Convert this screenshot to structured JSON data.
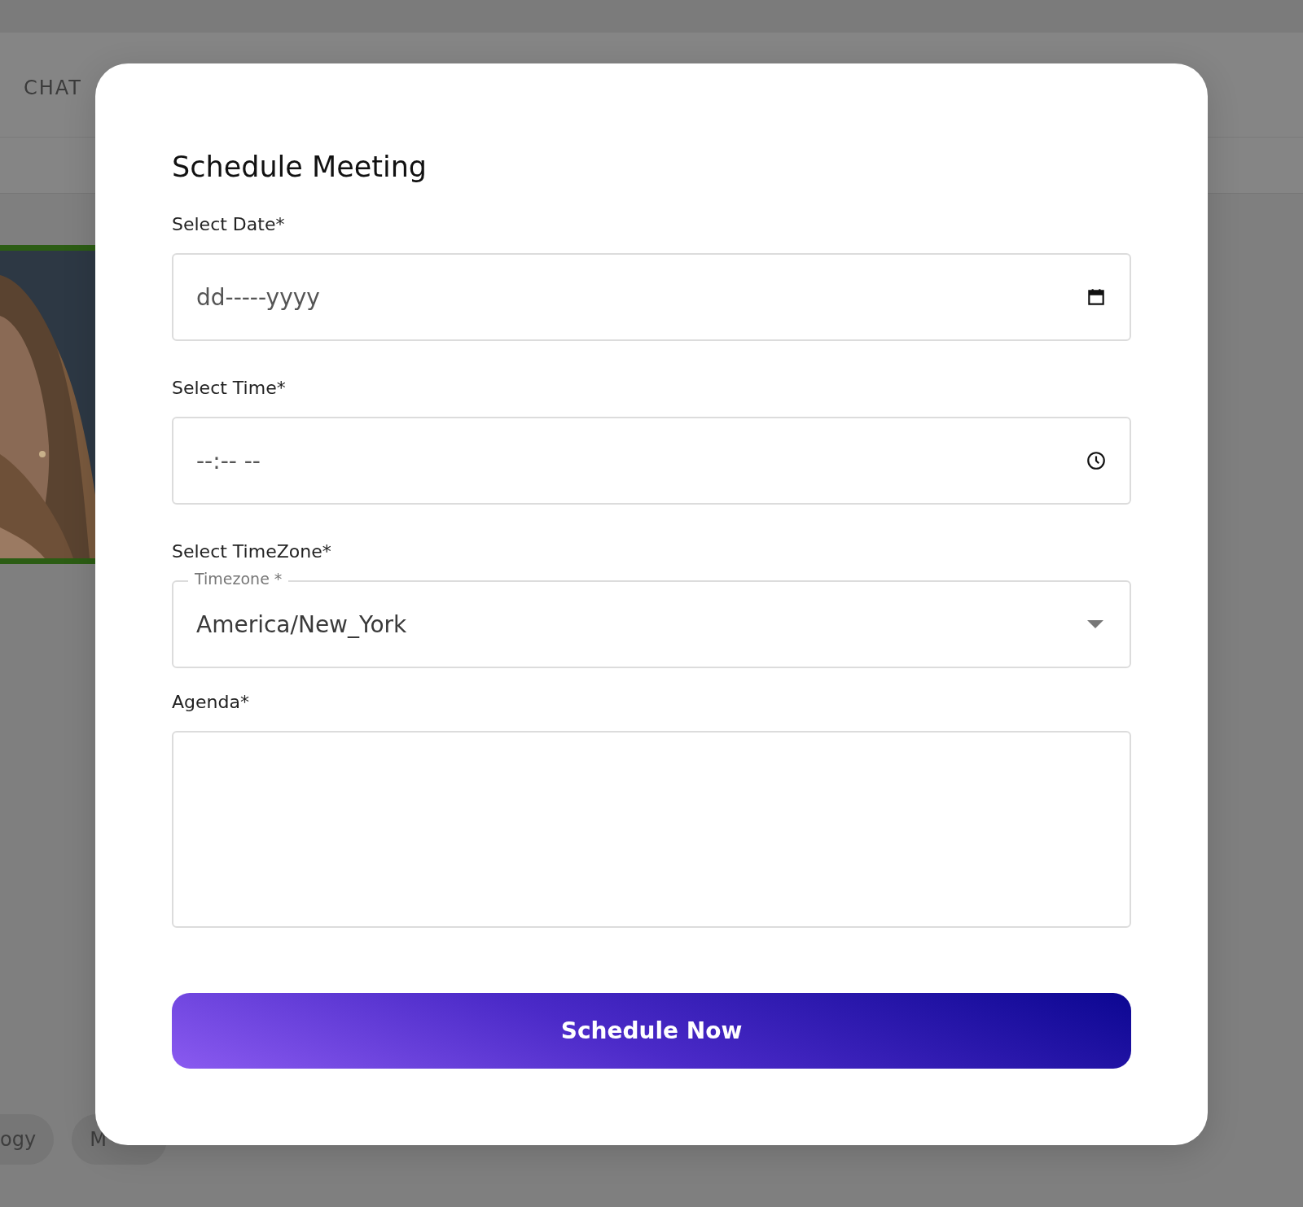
{
  "background": {
    "nav": [
      {
        "label": "CHAT"
      }
    ],
    "tags": [
      {
        "label": "ogy"
      },
      {
        "label": "M"
      }
    ]
  },
  "dialog": {
    "title": "Schedule Meeting",
    "fields": [
      {
        "kind": "date",
        "label": "Select Date*",
        "placeholder": "dd-----yyyy"
      },
      {
        "kind": "time",
        "label": "Select Time*",
        "placeholder": "--:-- --"
      },
      {
        "kind": "select",
        "label": "Select TimeZone*",
        "floating_label": "Timezone *",
        "value": "America/New_York"
      },
      {
        "kind": "textarea",
        "label": "Agenda*"
      }
    ],
    "button": "Schedule Now"
  }
}
